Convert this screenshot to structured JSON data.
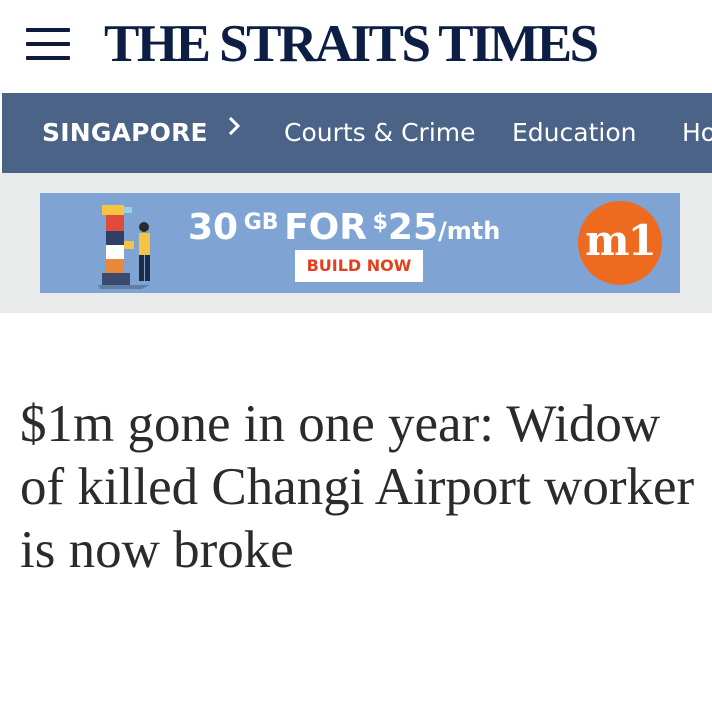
{
  "header": {
    "logo_text": "THE STRAITS TIMES",
    "menu_icon": "hamburger-menu-icon"
  },
  "nav": {
    "section": "SINGAPORE",
    "chevron_icon": "chevron-right-icon",
    "links": [
      "Courts & Crime",
      "Education",
      "Ho"
    ]
  },
  "ad": {
    "amount": "30",
    "unit": "GB",
    "for_text": "FOR",
    "currency": "$",
    "price": "25",
    "period": "/mth",
    "cta": "BUILD NOW",
    "brand": "m1",
    "colors": {
      "background": "#7fa4d4",
      "cta_text": "#e4401c",
      "brand_circle": "#ee6a1f"
    }
  },
  "article": {
    "headline": "$1m gone in one year: Widow of killed Changi Airport worker is now broke"
  },
  "colors": {
    "nav_background": "#4b6386",
    "logo": "#0d1e45",
    "ad_strip": "#e8ebea",
    "headline": "#2b2b2b"
  }
}
